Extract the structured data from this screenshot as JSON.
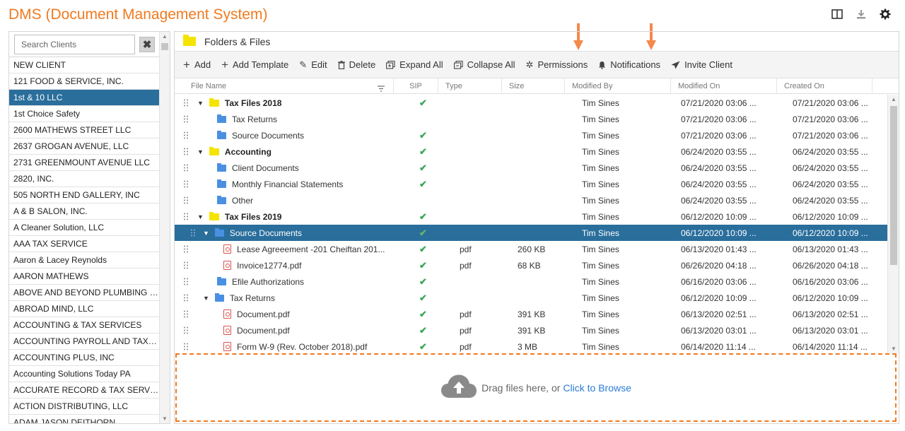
{
  "app": {
    "title": "DMS (Document Management System)"
  },
  "top_icons": [
    "columns-icon",
    "download-icon",
    "settings-gear-icon"
  ],
  "search": {
    "placeholder": "Search Clients",
    "value": "",
    "clear_label": "✖"
  },
  "clients": [
    "NEW CLIENT",
    "121 FOOD & SERVICE, INC.",
    "1st & 10 LLC",
    "1st Choice Safety",
    "2600 MATHEWS STREET LLC",
    "2637 GROGAN AVENUE, LLC",
    "2731 GREENMOUNT AVENUE LLC",
    "2820, INC.",
    "505 NORTH END GALLERY, INC",
    "A & B SALON, INC.",
    "A Cleaner Solution, LLC",
    "AAA TAX SERVICE",
    "Aaron & Lacey Reynolds",
    "AARON MATHEWS",
    "ABOVE AND BEYOND PLUMBING & ...",
    "ABROAD MIND, LLC",
    "ACCOUNTING & TAX SERVICES",
    "ACCOUNTING PAYROLL AND TAX S...",
    "ACCOUNTING PLUS, INC",
    "Accounting Solutions Today PA",
    "ACCURATE RECORD & TAX SERVICE",
    "ACTION DISTRIBUTING, LLC",
    "ADAM JASON DEITHORN"
  ],
  "selected_client": "1st & 10 LLC",
  "panel": {
    "title": "Folders & Files"
  },
  "toolbar": {
    "add": "Add",
    "add_template": "Add Template",
    "edit": "Edit",
    "delete": "Delete",
    "expand_all": "Expand All",
    "collapse_all": "Collapse All",
    "permissions": "Permissions",
    "notifications": "Notifications",
    "invite_client": "Invite Client"
  },
  "columns": {
    "file_name": "File Name",
    "sip": "SIP",
    "type": "Type",
    "size": "Size",
    "modified_by": "Modified By",
    "modified_on": "Modified On",
    "created_on": "Created On"
  },
  "rows": [
    {
      "level": 0,
      "kind": "folder-y",
      "expanded": true,
      "name": "Tax Files 2018",
      "sip": true,
      "type": "",
      "size": "",
      "modified_by": "Tim Sines",
      "modified_on": "07/21/2020 03:06 ...",
      "created_on": "07/21/2020 03:06 ..."
    },
    {
      "level": 1,
      "kind": "folder-b",
      "expanded": null,
      "name": "Tax Returns",
      "sip": false,
      "type": "",
      "size": "",
      "modified_by": "Tim Sines",
      "modified_on": "07/21/2020 03:06 ...",
      "created_on": "07/21/2020 03:06 ..."
    },
    {
      "level": 1,
      "kind": "folder-b",
      "expanded": null,
      "name": "Source Documents",
      "sip": true,
      "type": "",
      "size": "",
      "modified_by": "Tim Sines",
      "modified_on": "07/21/2020 03:06 ...",
      "created_on": "07/21/2020 03:06 ..."
    },
    {
      "level": 0,
      "kind": "folder-y",
      "expanded": true,
      "name": "Accounting",
      "sip": true,
      "type": "",
      "size": "",
      "modified_by": "Tim Sines",
      "modified_on": "06/24/2020 03:55 ...",
      "created_on": "06/24/2020 03:55 ..."
    },
    {
      "level": 1,
      "kind": "folder-b",
      "expanded": null,
      "name": "Client Documents",
      "sip": true,
      "type": "",
      "size": "",
      "modified_by": "Tim Sines",
      "modified_on": "06/24/2020 03:55 ...",
      "created_on": "06/24/2020 03:55 ..."
    },
    {
      "level": 1,
      "kind": "folder-b",
      "expanded": null,
      "name": "Monthly Financial Statements",
      "sip": true,
      "type": "",
      "size": "",
      "modified_by": "Tim Sines",
      "modified_on": "06/24/2020 03:55 ...",
      "created_on": "06/24/2020 03:55 ..."
    },
    {
      "level": 1,
      "kind": "folder-b",
      "expanded": null,
      "name": "Other",
      "sip": false,
      "type": "",
      "size": "",
      "modified_by": "Tim Sines",
      "modified_on": "06/24/2020 03:55 ...",
      "created_on": "06/24/2020 03:55 ..."
    },
    {
      "level": 0,
      "kind": "folder-y",
      "expanded": true,
      "name": "Tax Files 2019",
      "sip": true,
      "type": "",
      "size": "",
      "modified_by": "Tim Sines",
      "modified_on": "06/12/2020 10:09 ...",
      "created_on": "06/12/2020 10:09 ..."
    },
    {
      "level": 1,
      "kind": "folder-b",
      "expanded": true,
      "selected": true,
      "name": "Source Documents",
      "sip": true,
      "type": "",
      "size": "",
      "modified_by": "Tim Sines",
      "modified_on": "06/12/2020 10:09 ...",
      "created_on": "06/12/2020 10:09 ..."
    },
    {
      "level": 2,
      "kind": "pdf",
      "expanded": null,
      "name": "Lease Agreeement -201 Cheiftan 201...",
      "sip": true,
      "type": "pdf",
      "size": "260 KB",
      "modified_by": "Tim Sines",
      "modified_on": "06/13/2020 01:43 ...",
      "created_on": "06/13/2020 01:43 ..."
    },
    {
      "level": 2,
      "kind": "pdf",
      "expanded": null,
      "name": "Invoice12774.pdf",
      "sip": true,
      "type": "pdf",
      "size": "68 KB",
      "modified_by": "Tim Sines",
      "modified_on": "06/26/2020 04:18 ...",
      "created_on": "06/26/2020 04:18 ..."
    },
    {
      "level": 1,
      "kind": "folder-b",
      "expanded": null,
      "name": "Efile Authorizations",
      "sip": true,
      "type": "",
      "size": "",
      "modified_by": "Tim Sines",
      "modified_on": "06/16/2020 03:06 ...",
      "created_on": "06/16/2020 03:06 ..."
    },
    {
      "level": 1,
      "kind": "folder-b",
      "expanded": true,
      "name": "Tax Returns",
      "sip": true,
      "type": "",
      "size": "",
      "modified_by": "Tim Sines",
      "modified_on": "06/12/2020 10:09 ...",
      "created_on": "06/12/2020 10:09 ..."
    },
    {
      "level": 2,
      "kind": "pdf",
      "expanded": null,
      "name": "Document.pdf",
      "sip": true,
      "type": "pdf",
      "size": "391 KB",
      "modified_by": "Tim Sines",
      "modified_on": "06/13/2020 02:51 ...",
      "created_on": "06/13/2020 02:51 ..."
    },
    {
      "level": 2,
      "kind": "pdf",
      "expanded": null,
      "name": "Document.pdf",
      "sip": true,
      "type": "pdf",
      "size": "391 KB",
      "modified_by": "Tim Sines",
      "modified_on": "06/13/2020 03:01 ...",
      "created_on": "06/13/2020 03:01 ..."
    },
    {
      "level": 2,
      "kind": "pdf",
      "expanded": null,
      "name": "Form W-9 (Rev. October 2018).pdf",
      "sip": true,
      "type": "pdf",
      "size": "3 MB",
      "modified_by": "Tim Sines",
      "modified_on": "06/14/2020 11:14 ...",
      "created_on": "06/14/2020 11:14 ..."
    }
  ],
  "dropzone": {
    "text": "Drag files here, or",
    "browse": "Click to Browse"
  },
  "colors": {
    "accent": "#f07a1f",
    "selected": "#2a6e9c",
    "link": "#2a7bd6",
    "check": "#3aa757"
  }
}
